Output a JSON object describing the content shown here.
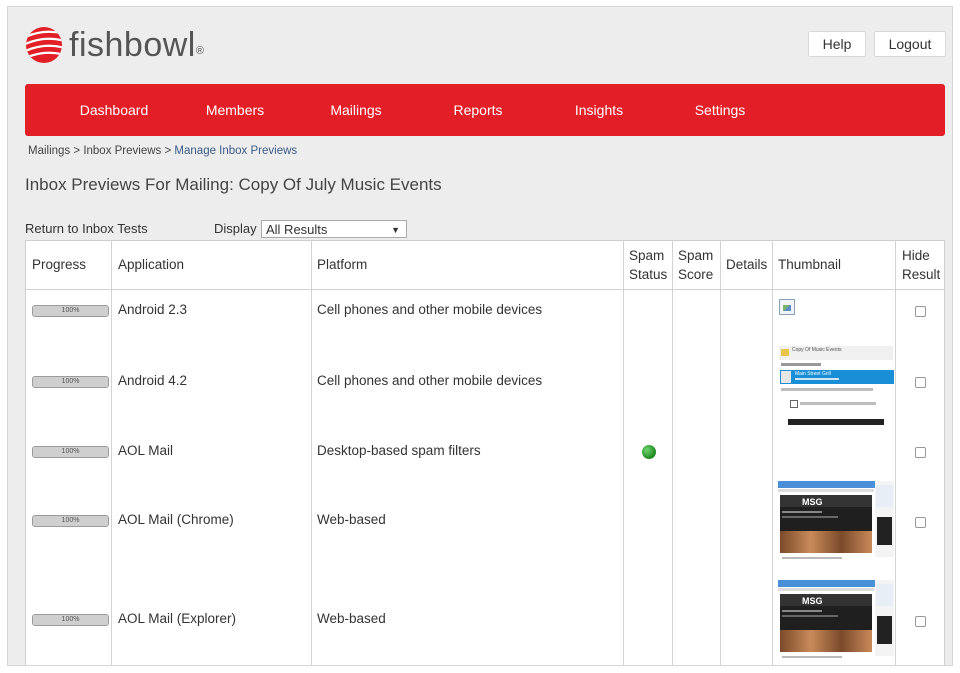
{
  "brand": {
    "name": "fishbowl",
    "reg": "®",
    "color": "#e21e26"
  },
  "header": {
    "help_label": "Help",
    "logout_label": "Logout"
  },
  "nav": {
    "items": [
      "Dashboard",
      "Members",
      "Mailings",
      "Reports",
      "Insights",
      "Settings"
    ]
  },
  "breadcrumb": {
    "items": [
      "Mailings",
      "Inbox Previews",
      "Manage Inbox Previews"
    ],
    "separator": ">"
  },
  "page_title": "Inbox Previews For Mailing: Copy Of July Music Events",
  "toolbar": {
    "return_label": "Return to Inbox Tests",
    "display_label": "Display",
    "display_value": "All Results"
  },
  "table": {
    "headers": {
      "progress": "Progress",
      "application": "Application",
      "platform": "Platform",
      "spam_status_1": "Spam",
      "spam_status_2": "Status",
      "spam_score_1": "Spam",
      "spam_score_2": "Score",
      "details": "Details",
      "thumbnail": "Thumbnail",
      "hide_1": "Hide",
      "hide_2": "Result"
    },
    "rows": [
      {
        "progress": 100,
        "progress_label": "100%",
        "application": "Android 2.3",
        "platform": "Cell phones and other mobile devices",
        "spam_status": "",
        "thumbnail": "broken-image-icon",
        "hidden": false
      },
      {
        "progress": 100,
        "progress_label": "100%",
        "application": "Android 4.2",
        "platform": "Cell phones and other mobile devices",
        "spam_status": "",
        "thumbnail": "mobile-email-thumbnail",
        "hidden": false
      },
      {
        "progress": 100,
        "progress_label": "100%",
        "application": "AOL Mail",
        "platform": "Desktop-based spam filters",
        "spam_status": "green",
        "thumbnail": "",
        "hidden": false
      },
      {
        "progress": 100,
        "progress_label": "100%",
        "application": "AOL Mail (Chrome)",
        "platform": "Web-based",
        "spam_status": "",
        "thumbnail": "web-email-thumbnail",
        "hidden": false
      },
      {
        "progress": 100,
        "progress_label": "100%",
        "application": "AOL Mail (Explorer)",
        "platform": "Web-based",
        "spam_status": "",
        "thumbnail": "web-email-thumbnail",
        "hidden": false
      }
    ],
    "thumb_text": {
      "mobile_title": "Copy Of Music Events",
      "mobile_sender": "Main Street Grill",
      "web_logo": "MSG"
    }
  },
  "colors": {
    "spam_ok": "#2a9a2a",
    "link": "#3a5a86"
  }
}
